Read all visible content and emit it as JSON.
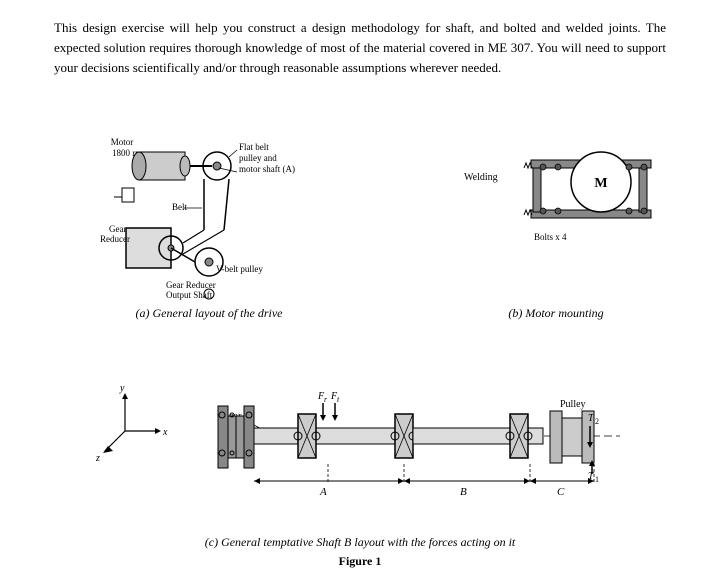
{
  "intro": {
    "text": "This design exercise will help you construct a design methodology for shaft, and bolted and welded joints. The expected solution requires thorough knowledge of most of the material covered in ME 307. You will need to support your decisions scientifically and/or through reasonable assumptions wherever needed."
  },
  "figure": {
    "caption_c": "(c) General temptative Shaft B layout with the forces acting on it",
    "caption_fig": "Figure 1",
    "subfig_a_label": "(a) General layout of the drive",
    "subfig_b_label": "(b) Motor mounting"
  }
}
